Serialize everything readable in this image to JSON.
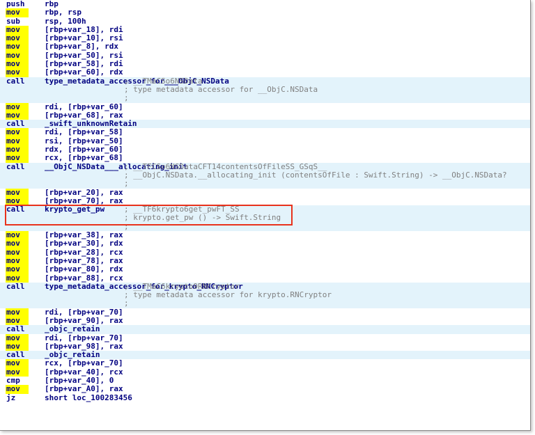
{
  "disassembly": {
    "lines": [
      {
        "m": "push",
        "op": "rbp",
        "c": "",
        "hl": false,
        "y": false
      },
      {
        "m": "mov",
        "op": "rbp, rsp",
        "c": "",
        "hl": false,
        "y": true
      },
      {
        "m": "sub",
        "op": "rsp, 100h",
        "c": "",
        "hl": false,
        "y": false
      },
      {
        "m": "mov",
        "op": "[rbp+var_18], rdi",
        "c": "",
        "hl": false,
        "y": true
      },
      {
        "m": "mov",
        "op": "[rbp+var_10], rsi",
        "c": "",
        "hl": false,
        "y": true
      },
      {
        "m": "mov",
        "op": "[rbp+var_8], rdx",
        "c": "",
        "hl": false,
        "y": true
      },
      {
        "m": "mov",
        "op": "[rbp+var_50], rsi",
        "c": "",
        "hl": false,
        "y": true
      },
      {
        "m": "mov",
        "op": "[rbp+var_58], rdi",
        "c": "",
        "hl": false,
        "y": true
      },
      {
        "m": "mov",
        "op": "[rbp+var_60], rdx",
        "c": "",
        "hl": false,
        "y": true
      },
      {
        "m": "call",
        "op": "type_metadata_accessor_for___ObjC_NSData",
        "c": "; __TMaCSo6NSData",
        "hl": true,
        "y": false
      },
      {
        "m": "",
        "op": "",
        "c": "; type metadata accessor for __ObjC.NSData",
        "hl": true,
        "y": false
      },
      {
        "m": "",
        "op": "",
        "c": ";",
        "hl": true,
        "y": false
      },
      {
        "m": "mov",
        "op": "rdi, [rbp+var_60]",
        "c": "",
        "hl": false,
        "y": true
      },
      {
        "m": "mov",
        "op": "[rbp+var_68], rax",
        "c": "",
        "hl": false,
        "y": true
      },
      {
        "m": "call",
        "op": "_swift_unknownRetain",
        "c": "",
        "hl": true,
        "y": false
      },
      {
        "m": "mov",
        "op": "rdi, [rbp+var_58]",
        "c": "",
        "hl": false,
        "y": true
      },
      {
        "m": "mov",
        "op": "rsi, [rbp+var_50]",
        "c": "",
        "hl": false,
        "y": true
      },
      {
        "m": "mov",
        "op": "rdx, [rbp+var_60]",
        "c": "",
        "hl": false,
        "y": true
      },
      {
        "m": "mov",
        "op": "rcx, [rbp+var_68]",
        "c": "",
        "hl": false,
        "y": true
      },
      {
        "m": "call",
        "op": "__ObjC_NSData___allocating_init",
        "c": "; __TFCSo6NSDataCFT14contentsOfFileSS_GSqS__",
        "hl": true,
        "y": false
      },
      {
        "m": "",
        "op": "",
        "c": "; __ObjC.NSData.__allocating_init (contentsOfFile : Swift.String) -> __ObjC.NSData?",
        "hl": true,
        "y": false
      },
      {
        "m": "",
        "op": "",
        "c": ";",
        "hl": true,
        "y": false
      },
      {
        "m": "mov",
        "op": "[rbp+var_20], rax",
        "c": "",
        "hl": false,
        "y": true
      },
      {
        "m": "mov",
        "op": "[rbp+var_70], rax",
        "c": "",
        "hl": false,
        "y": true
      },
      {
        "m": "call",
        "op": "krypto_get_pw",
        "c": "; __TF6krypto6get_pwFT_SS",
        "hl": true,
        "y": false
      },
      {
        "m": "",
        "op": "",
        "c": "; krypto.get_pw () -> Swift.String",
        "hl": true,
        "y": false
      },
      {
        "m": "",
        "op": "",
        "c": ";",
        "hl": true,
        "y": false
      },
      {
        "m": "mov",
        "op": "[rbp+var_38], rax",
        "c": "",
        "hl": false,
        "y": true
      },
      {
        "m": "mov",
        "op": "[rbp+var_30], rdx",
        "c": "",
        "hl": false,
        "y": true
      },
      {
        "m": "mov",
        "op": "[rbp+var_28], rcx",
        "c": "",
        "hl": false,
        "y": true
      },
      {
        "m": "mov",
        "op": "[rbp+var_78], rax",
        "c": "",
        "hl": false,
        "y": true
      },
      {
        "m": "mov",
        "op": "[rbp+var_80], rdx",
        "c": "",
        "hl": false,
        "y": true
      },
      {
        "m": "mov",
        "op": "[rbp+var_88], rcx",
        "c": "",
        "hl": false,
        "y": true
      },
      {
        "m": "call",
        "op": "type_metadata_accessor_for_krypto_RNCryptor",
        "c": "; __TMaC6krypto9RNCryptor",
        "hl": true,
        "y": false
      },
      {
        "m": "",
        "op": "",
        "c": "; type metadata accessor for krypto.RNCryptor",
        "hl": true,
        "y": false
      },
      {
        "m": "",
        "op": "",
        "c": ";",
        "hl": true,
        "y": false
      },
      {
        "m": "mov",
        "op": "rdi, [rbp+var_70]",
        "c": "",
        "hl": false,
        "y": true
      },
      {
        "m": "mov",
        "op": "[rbp+var_90], rax",
        "c": "",
        "hl": false,
        "y": true
      },
      {
        "m": "call",
        "op": "_objc_retain",
        "c": "",
        "hl": true,
        "y": false
      },
      {
        "m": "mov",
        "op": "rdi, [rbp+var_70]",
        "c": "",
        "hl": false,
        "y": true
      },
      {
        "m": "mov",
        "op": "[rbp+var_98], rax",
        "c": "",
        "hl": false,
        "y": true
      },
      {
        "m": "call",
        "op": "_objc_retain",
        "c": "",
        "hl": true,
        "y": false
      },
      {
        "m": "mov",
        "op": "rcx, [rbp+var_70]",
        "c": "",
        "hl": false,
        "y": true
      },
      {
        "m": "mov",
        "op": "[rbp+var_40], rcx",
        "c": "",
        "hl": false,
        "y": true
      },
      {
        "m": "cmp",
        "op": "[rbp+var_40], 0",
        "c": "",
        "hl": false,
        "y": false
      },
      {
        "m": "mov",
        "op": "[rbp+var_A0], rax",
        "c": "",
        "hl": false,
        "y": true
      },
      {
        "m": "jz",
        "op": "short loc_100283456",
        "c": "",
        "hl": false,
        "y": false
      }
    ]
  },
  "colors": {
    "instruction": "#000080",
    "comment": "#808080",
    "call_highlight": "#e3f3fb",
    "mov_highlight": "#ffff00",
    "annotation_box": "#e8321c"
  },
  "annotation": {
    "target_line": 24
  }
}
